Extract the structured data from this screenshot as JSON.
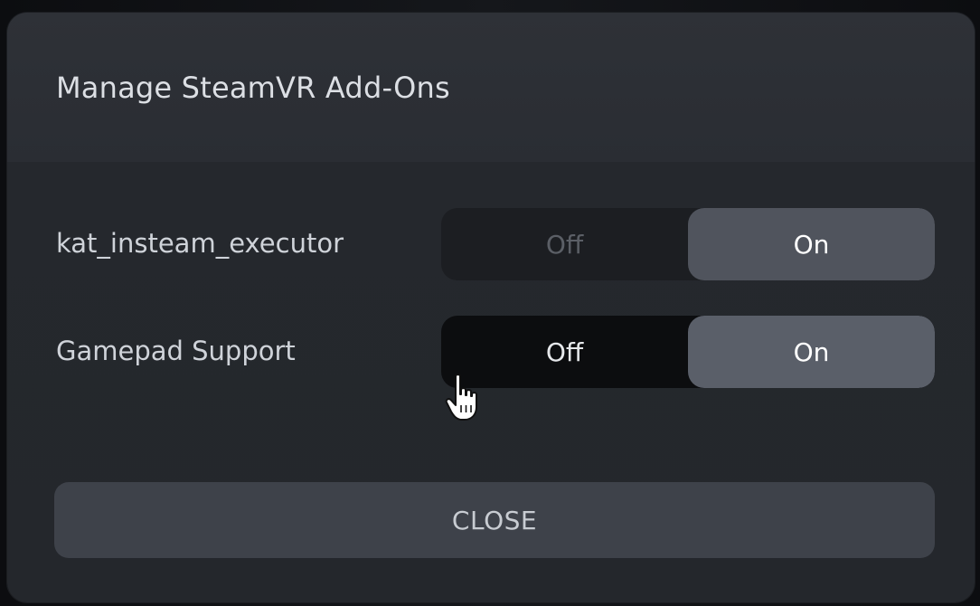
{
  "dialog": {
    "title": "Manage SteamVR Add-Ons",
    "addons": [
      {
        "name": "kat_insteam_executor",
        "off_label": "Off",
        "on_label": "On",
        "state": "On"
      },
      {
        "name": "Gamepad Support",
        "off_label": "Off",
        "on_label": "On",
        "state": "On"
      }
    ],
    "close_label": "CLOSE"
  },
  "colors": {
    "dialog_bg": "#25282d",
    "toggle_on_bg": "#50545d",
    "close_bg": "#3e424a"
  },
  "icons": {
    "cursor": "hand-pointer-icon"
  }
}
